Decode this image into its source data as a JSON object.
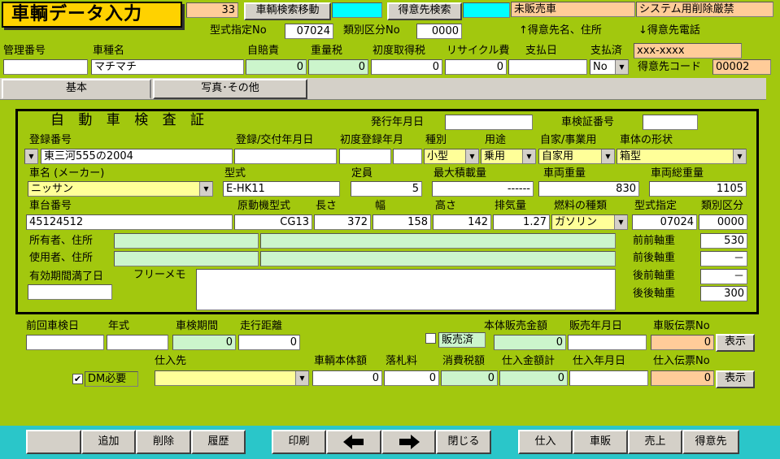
{
  "header": {
    "title": "車輌データ入力",
    "record_no": "33",
    "vehicle_search_btn": "車輌検索移動",
    "customer_search_btn": "得意先検索",
    "unsold_status": "未販売車",
    "system_notice": "システム用削除厳禁",
    "model_spec_label": "型式指定No",
    "model_spec_value": "07024",
    "class_label": "類別区分No",
    "class_value": "0000",
    "hint_up": "↑得意先名、住所",
    "hint_down": "↓得意先電話"
  },
  "top": {
    "mgmt_no_label": "管理番号",
    "mgmt_no_value": "",
    "model_name_label": "車種名",
    "model_name_value": "マチマチ",
    "jibaiseki_label": "自賠責",
    "jibaiseki_value": "0",
    "tax_label": "重量税",
    "tax_value": "0",
    "acq_tax_label": "初度取得税",
    "acq_tax_value": "0",
    "recycle_label": "リサイクル費",
    "recycle_value": "0",
    "pay_date_label": "支払日",
    "pay_date_value": "",
    "paid_label": "支払済",
    "paid_value": "No",
    "customer_name": "xxx-xxxx",
    "customer_code_label": "得意先コード",
    "customer_code_value": "00002"
  },
  "tabs": {
    "basic": "基本",
    "photo": "写真･その他"
  },
  "inspection": {
    "title": "自 動 車 検 査 証",
    "issue_date_label": "発行年月日",
    "issue_date_value": "",
    "cert_no_label": "車検証番号",
    "cert_no_value": "",
    "reg_no_label": "登録番号",
    "reg_no_value": "東三河555の2004",
    "reg_date_label": "登録/交付年月日",
    "reg_date_value": "",
    "first_reg_label": "初度登録年月",
    "first_reg_value1": "",
    "first_reg_value2": "",
    "type_label": "種別",
    "type_value": "小型",
    "use_label": "用途",
    "use_value": "乗用",
    "private_label": "自家/事業用",
    "private_value": "自家用",
    "body_label": "車体の形状",
    "body_value": "箱型",
    "maker_label": "車名 (メーカー)",
    "maker_value": "ニッサン",
    "model_label": "型式",
    "model_value": "E-HK11",
    "capacity_label": "定員",
    "capacity_value": "5",
    "max_load_label": "最大積載量",
    "max_load_value": "------",
    "weight_label": "車両重量",
    "weight_value": "830",
    "gross_label": "車両総重量",
    "gross_value": "1105",
    "chassis_label": "車台番号",
    "chassis_value": "45124512",
    "engine_label": "原動機型式",
    "engine_value": "CG13",
    "length_label": "長さ",
    "length_value": "372",
    "width_label": "幅",
    "width_value": "158",
    "height_label": "高さ",
    "height_value": "142",
    "disp_label": "排気量",
    "disp_value": "1.27",
    "fuel_label": "燃料の種類",
    "fuel_value": "ガソリン",
    "spec_label": "型式指定",
    "spec_value": "07024",
    "cls_label": "類別区分",
    "cls_value": "0000",
    "owner_label": "所有者、住所",
    "user_label": "使用者、住所",
    "owner_name": "",
    "owner_addr": "",
    "user_name": "",
    "user_addr": "",
    "ff_axle_label": "前前軸重",
    "ff_axle_value": "530",
    "fr_axle_label": "前後軸重",
    "fr_axle_value": "－",
    "rf_axle_label": "後前軸重",
    "rf_axle_value": "－",
    "rr_axle_label": "後後軸重",
    "rr_axle_value": "300",
    "expiry_label": "有効期間満了日",
    "expiry_value": "",
    "memo_label": "フリーメモ",
    "memo_value": ""
  },
  "lower": {
    "prev_insp_label": "前回車検日",
    "prev_insp_value": "",
    "year_label": "年式",
    "year_value": "",
    "period_label": "車検期間",
    "period_value": "0",
    "mileage_label": "走行距離",
    "mileage_value": "0",
    "sold_label": "販売済",
    "body_price_label": "本体販売金額",
    "body_price_value": "0",
    "sale_date_label": "販売年月日",
    "sale_date_value": "",
    "sale_slip_label": "車販伝票No",
    "sale_slip_value": "0",
    "show_btn": "表示",
    "dm_label": "DM必要",
    "supplier_label": "仕入先",
    "supplier_value": "",
    "car_price_label": "車輌本体額",
    "car_price_value": "0",
    "fee_label": "落札料",
    "fee_value": "0",
    "tax_label": "消費税額",
    "tax_value": "0",
    "total_label": "仕入金額計",
    "total_value": "0",
    "pur_date_label": "仕入年月日",
    "pur_date_value": "",
    "pur_slip_label": "仕入伝票No",
    "pur_slip_value": "0"
  },
  "footer": {
    "blank": "",
    "add": "追加",
    "delete": "削除",
    "history": "履歴",
    "print": "印刷",
    "close": "閉じる",
    "purchase": "仕入",
    "car_sale": "車販",
    "sales": "売上",
    "customer": "得意先"
  }
}
